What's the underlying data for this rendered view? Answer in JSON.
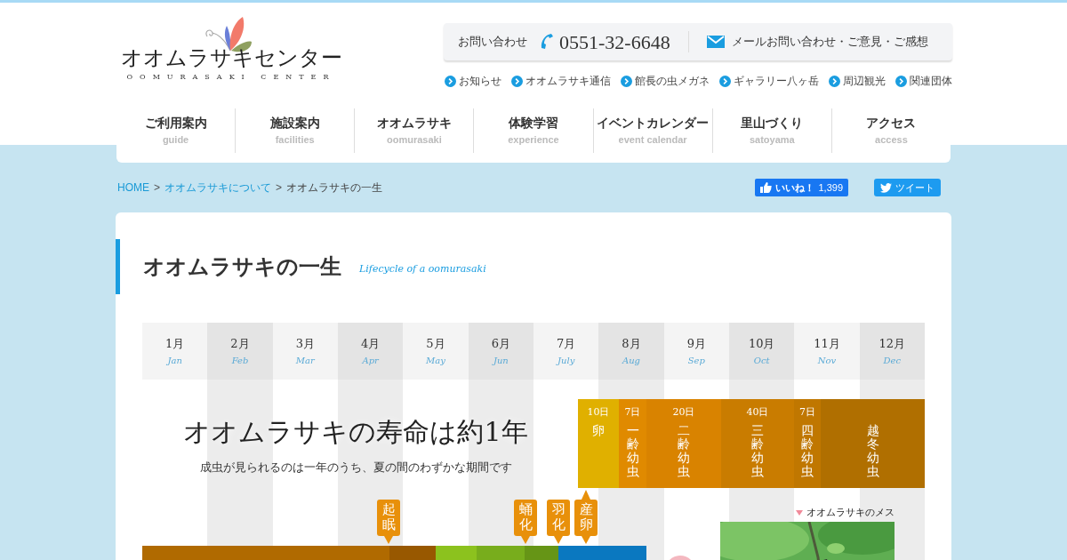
{
  "logo": {
    "title": "オオムラサキセンター",
    "subtitle": "OOMURASAKI CENTER"
  },
  "contact": {
    "label": "お問い合わせ",
    "phone": "0551-32-6648",
    "mail": "メールお問い合わせ・ご意見・ご感想"
  },
  "sub_links": [
    "お知らせ",
    "オオムラサキ通信",
    "館長の虫メガネ",
    "ギャラリー八ヶ岳",
    "周辺観光",
    "関連団体"
  ],
  "nav": [
    {
      "ja": "ご利用案内",
      "en": "guide"
    },
    {
      "ja": "施設案内",
      "en": "facilities"
    },
    {
      "ja": "オオムラサキ",
      "en": "oomurasaki"
    },
    {
      "ja": "体験学習",
      "en": "experience"
    },
    {
      "ja": "イベントカレンダー",
      "en": "event calendar"
    },
    {
      "ja": "里山づくり",
      "en": "satoyama"
    },
    {
      "ja": "アクセス",
      "en": "access"
    }
  ],
  "breadcrumb": [
    {
      "label": "HOME",
      "link": true
    },
    {
      "label": "オオムラサキについて",
      "link": true
    },
    {
      "label": "オオムラサキの一生",
      "link": false
    }
  ],
  "separator": ">",
  "social": {
    "like": "いいね！",
    "like_count": "1,399",
    "tweet": "ツイート"
  },
  "heading": {
    "title": "オオムラサキの一生",
    "subtitle": "Lifecycle of a oomurasaki"
  },
  "months": [
    {
      "ja": "1月",
      "en": "Jan"
    },
    {
      "ja": "2月",
      "en": "Feb"
    },
    {
      "ja": "3月",
      "en": "Mar"
    },
    {
      "ja": "4月",
      "en": "Apr"
    },
    {
      "ja": "5月",
      "en": "May"
    },
    {
      "ja": "6月",
      "en": "Jun"
    },
    {
      "ja": "7月",
      "en": "July"
    },
    {
      "ja": "8月",
      "en": "Aug"
    },
    {
      "ja": "9月",
      "en": "Sep"
    },
    {
      "ja": "10月",
      "en": "Oct"
    },
    {
      "ja": "11月",
      "en": "Nov"
    },
    {
      "ja": "12月",
      "en": "Dec"
    }
  ],
  "lifespan": {
    "title": "オオムラサキの寿命は約1年",
    "subtitle": "成虫が見られるのは一年のうち、夏の間のわずかな期間です"
  },
  "stages": [
    {
      "days": "10日",
      "label": "卵",
      "color": "#e0b000"
    },
    {
      "days": "7日",
      "label": "一齢幼虫",
      "color": "#e08a00"
    },
    {
      "days": "20日",
      "label": "二齢幼虫",
      "color": "#d98300"
    },
    {
      "days": "40日",
      "label": "三齢幼虫",
      "color": "#c97c00"
    },
    {
      "days": "7日",
      "label": "四齢幼虫",
      "color": "#c07700"
    },
    {
      "label": "越冬幼虫",
      "color": "#b06f00"
    }
  ],
  "markers": [
    {
      "label": "起眠",
      "kind": "down"
    },
    {
      "label": "蛹化",
      "kind": "down"
    },
    {
      "label": "羽化",
      "kind": "down"
    },
    {
      "label": "産卵",
      "kind": "both"
    }
  ],
  "periods": [
    {
      "color": "#b06a00"
    },
    {
      "color": "#985800"
    },
    {
      "color": "#8cc21e"
    },
    {
      "color": "#78ad1c"
    },
    {
      "color": "#669516"
    },
    {
      "color": "#0a78c0"
    }
  ],
  "photo": {
    "caption": "オオムラサキのメス",
    "kind": "picture"
  }
}
